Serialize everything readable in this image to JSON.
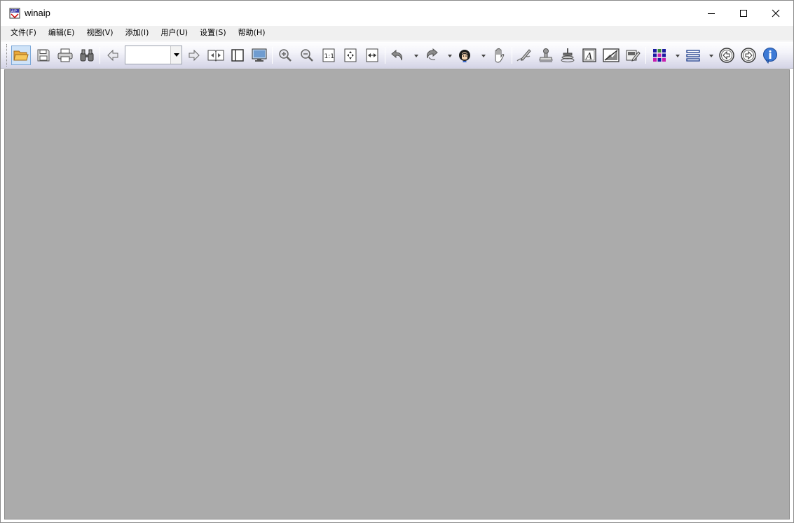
{
  "window": {
    "title": "winaip",
    "minimize_icon": "minimize-icon",
    "maximize_icon": "maximize-icon",
    "close_icon": "close-icon"
  },
  "menubar": {
    "items": [
      "文件(F)",
      "编辑(E)",
      "视图(V)",
      "添加(I)",
      "用户(U)",
      "设置(S)",
      "帮助(H)"
    ]
  },
  "toolbar": {
    "page_input_value": "",
    "icons": [
      "open-folder-icon",
      "save-icon",
      "print-icon",
      "find-binoculars-icon",
      "previous-page-icon",
      "page-number-combo",
      "next-page-icon",
      "two-page-book-icon",
      "single-page-icon",
      "fullscreen-monitor-icon",
      "zoom-in-icon",
      "zoom-out-icon",
      "actual-size-icon",
      "fit-page-icon",
      "fit-width-icon",
      "undo-icon",
      "redo-icon",
      "user-face-icon",
      "hand-pan-icon",
      "sign-pen-icon",
      "stamp-icon",
      "seal-stamp-icon",
      "text-box-icon",
      "image-icon",
      "edit-note-icon",
      "color-grid-icon",
      "layers-list-icon",
      "back-circle-icon",
      "forward-circle-icon",
      "info-icon"
    ],
    "colors": {
      "active_bg": "#cfe3f8",
      "workspace": "#ababab"
    }
  }
}
